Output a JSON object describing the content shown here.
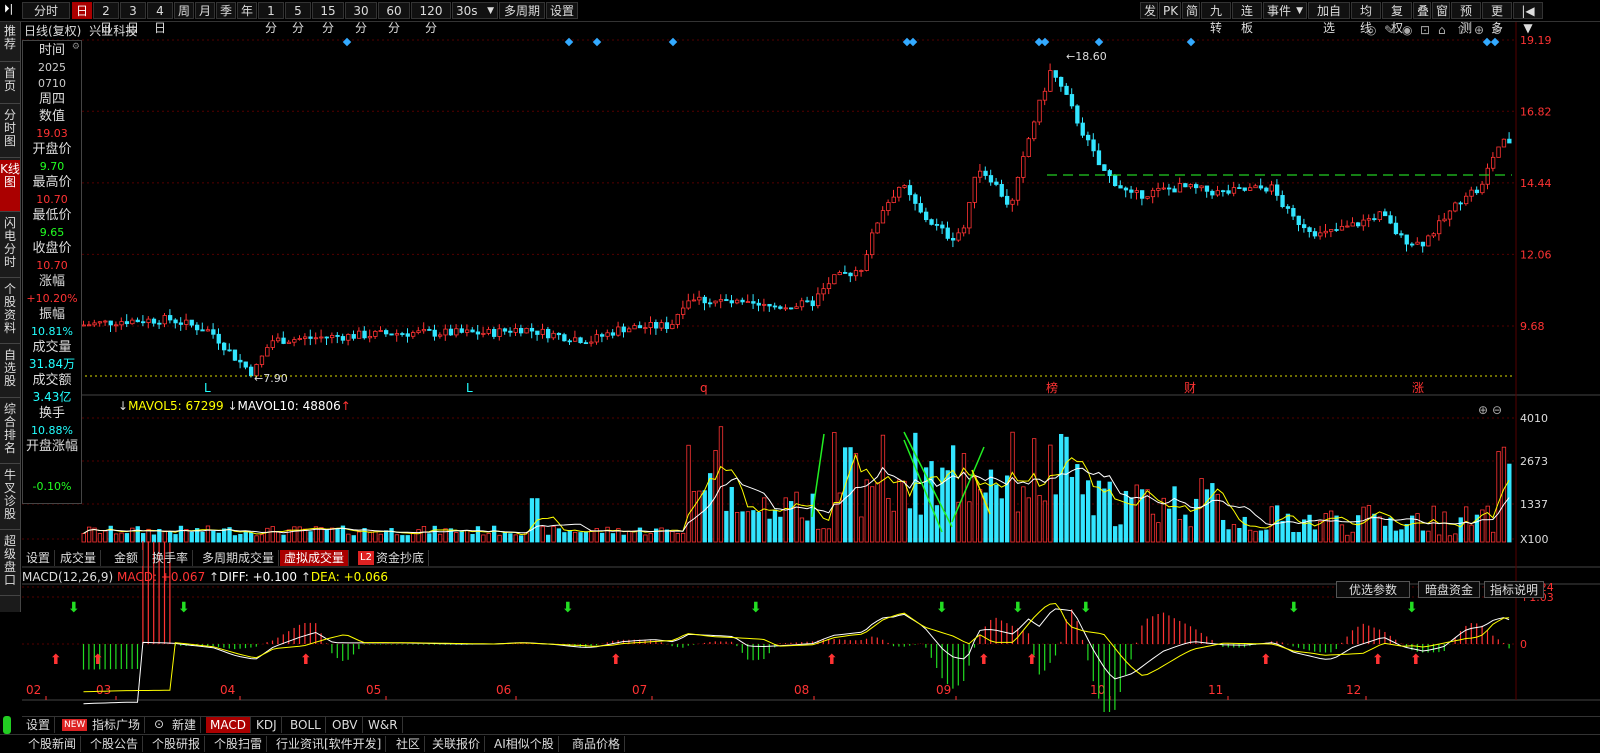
{
  "toolbar": {
    "items": [
      "分时",
      "日",
      "2日",
      "3日",
      "4日",
      "周",
      "月",
      "季",
      "年",
      "1分",
      "5分",
      "15分",
      "30分",
      "60分",
      "120分",
      "30s",
      "多周期",
      "设置"
    ],
    "right": [
      "发",
      "PK",
      "简",
      "九转",
      "连板",
      "事件",
      "加自选",
      "均线",
      "复权",
      "叠",
      "窗",
      "预测",
      "更多"
    ]
  },
  "leftnav": [
    "推荐",
    "首页",
    "分时图",
    "K线图",
    "闪电分时",
    "个股资料",
    "自选股",
    "综合排名",
    "牛叉诊股",
    "超级盘口"
  ],
  "header": {
    "title": "日线(复权)",
    "stock": "兴业科技"
  },
  "info": {
    "time_label": "时间",
    "year": "2025",
    "date": "0710",
    "weekday": "周四",
    "value_label": "数值",
    "value": "19.03",
    "open_label": "开盘价",
    "open": "9.70",
    "high_label": "最高价",
    "high": "10.70",
    "low_label": "最低价",
    "low": "9.65",
    "close_label": "收盘价",
    "close": "10.70",
    "chg_label": "涨幅",
    "chg": "+10.20%",
    "amp_label": "振幅",
    "amp": "10.81%",
    "vol_label": "成交量",
    "vol": "31.84万",
    "amt_label": "成交额",
    "amt": "3.43亿",
    "turn_label": "换手",
    "turn": "10.88%",
    "openchg_label": "开盘涨幅",
    "openchg": "-0.10%"
  },
  "price_axis": [
    "19.19",
    "16.82",
    "14.44",
    "12.06",
    "9.68"
  ],
  "price_annot": {
    "high": "18.60",
    "low": "7.90"
  },
  "markers": [
    "L",
    "L",
    "q",
    "榜",
    "财",
    "涨"
  ],
  "vol_header": {
    "mavol5": "MAVOL5: 67299",
    "mavol10": "MAVOL10: 48806"
  },
  "vol_axis": [
    "4010",
    "2673",
    "1337",
    "X100"
  ],
  "vol_tabs": [
    "设置",
    "成交量",
    "金额",
    "换手率",
    "多周期成交量",
    "虚拟成交量",
    "资金抄底"
  ],
  "vol_tab_badge": "L2",
  "macd_header": {
    "name": "MACD(12,26,9)",
    "macd": "MACD: +0.067",
    "diff": "DIFF: +0.100",
    "dea": "DEA: +0.066"
  },
  "macd_buttons": [
    "优选参数",
    "暗盘资金",
    "指标说明"
  ],
  "macd_axis": [
    "1.24",
    "1.03",
    "0"
  ],
  "months": [
    "02",
    "03",
    "04",
    "05",
    "06",
    "07",
    "08",
    "09",
    "10",
    "11",
    "12"
  ],
  "ind_tabs": [
    "设置",
    "指标广场",
    "新建",
    "MACD",
    "KDJ",
    "BOLL",
    "OBV",
    "W&R"
  ],
  "ind_badge": "NEW",
  "bottom": [
    "个股新闻",
    "个股公告",
    "个股研报",
    "个股扫雷",
    "行业资讯[软件开发]",
    "社区",
    "关联报价",
    "AI相似个股",
    "商品价格"
  ],
  "colors": {
    "up": "#ff3333",
    "down": "#33e5ff",
    "ma": "#ffff00",
    "ma2": "#ffffff",
    "grid": "#550000"
  }
}
